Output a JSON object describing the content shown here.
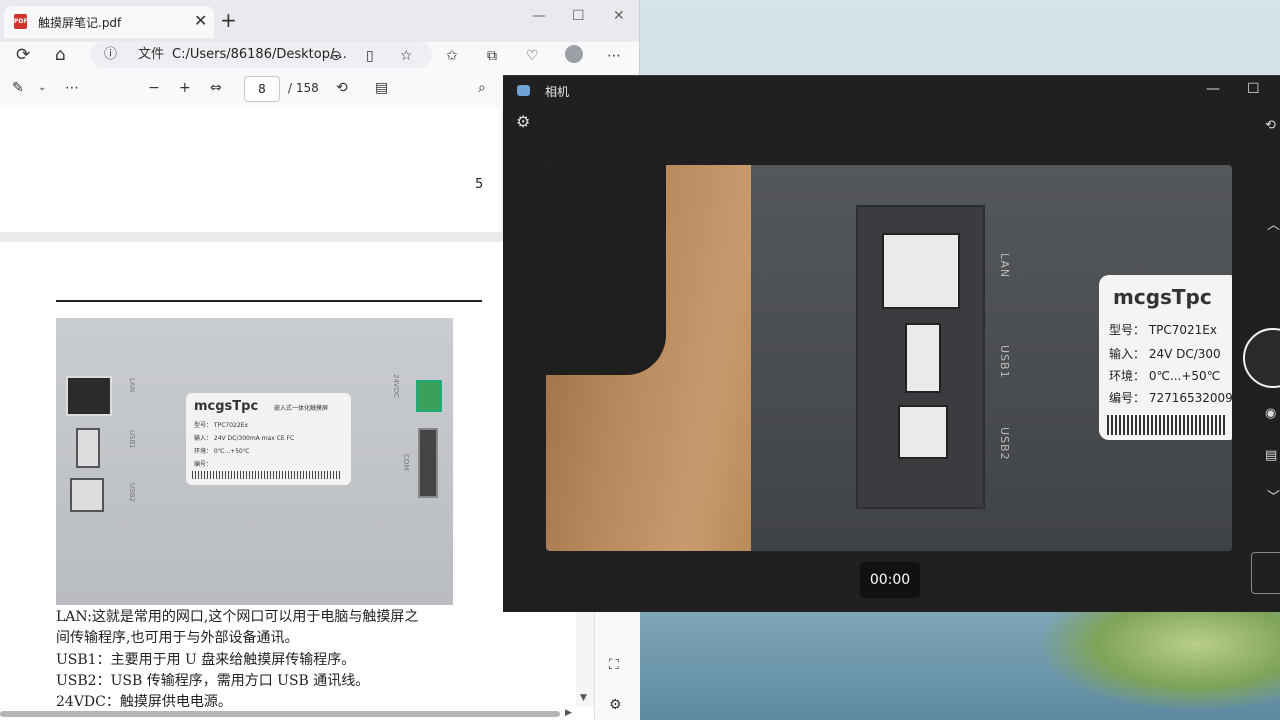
{
  "edge": {
    "tab_title": "触摸屏笔记.pdf",
    "pdf_icon_text": "PDF",
    "tab_close": "✕",
    "new_tab": "+",
    "win_min": "—",
    "win_max": "☐",
    "win_close": "✕",
    "url_site_label": "文件",
    "url_text": "C:/Users/86186/Desktop/...",
    "page_current": "8",
    "page_total": "/ 158"
  },
  "pdf": {
    "page_number": "5",
    "photo": {
      "logo": "mcgsTpc",
      "label_title": "嵌入式一体化触摸屏",
      "spec_model": "型号：  TPC7022Ex",
      "spec_input": "输入：  24V DC/300mA max   CE  FC",
      "spec_env": "环境：  0℃...+50℃",
      "spec_no": "编号：",
      "lan": "LAN",
      "usb1": "USB1",
      "usb2": "USB2",
      "vdc": "24VDC",
      "com": "COM"
    },
    "lines": [
      "LAN:这就是常用的网口,这个网口可以用于电脑与触摸屏之",
      "      间传输程序,也可用于与外部设备通讯。",
      "USB1：主要用于用 U 盘来给触摸屏传输程序。",
      "USB2：USB 传输程序，需用方口 USB 通讯线。",
      "24VDC：触摸屏供电电源。"
    ]
  },
  "camera": {
    "title": "相机",
    "win_min": "—",
    "win_max": "☐",
    "timer": "00:00",
    "label": {
      "logo": "mcgsTpc",
      "model": "型号：  TPC7021Ex",
      "input": "输入：  24V DC/300",
      "env": "环境：  0℃...+50℃",
      "no": "编号：  72716532009"
    },
    "lan": "LAN",
    "usb1": "USB1",
    "usb2": "USB2"
  }
}
